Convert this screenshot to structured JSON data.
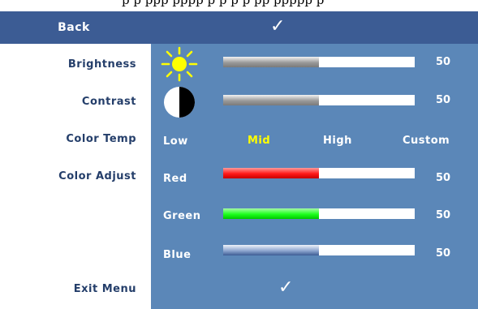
{
  "top_fragment": "p     p  ppp  pppp   p  p  p  p  pp  ppppp p",
  "back_label": "Back",
  "check_glyph": "✓",
  "rows": {
    "brightness": {
      "label": "Brightness",
      "value": "50",
      "level": 0.5,
      "icon": "sun-icon"
    },
    "contrast": {
      "label": "Contrast",
      "value": "50",
      "level": 0.5,
      "icon": "contrast-icon"
    }
  },
  "color_temp": {
    "label": "Color Temp",
    "options": [
      "Low",
      "Mid",
      "High",
      "Custom"
    ],
    "selected": "Mid",
    "selected_color": "#ffff00"
  },
  "color_adjust": {
    "label": "Color Adjust",
    "channels": [
      {
        "label": "Red",
        "value": "50",
        "level": 0.5,
        "color": "#ff2020"
      },
      {
        "label": "Green",
        "value": "50",
        "level": 0.5,
        "color": "#20ff20"
      },
      {
        "label": "Blue",
        "value": "50",
        "level": 0.5,
        "color": "#3c5c94"
      }
    ]
  },
  "exit_label": "Exit Menu",
  "colors": {
    "header_bar": "#3c5c94",
    "panel": "#5b87b8",
    "label_text": "#243e6a"
  }
}
